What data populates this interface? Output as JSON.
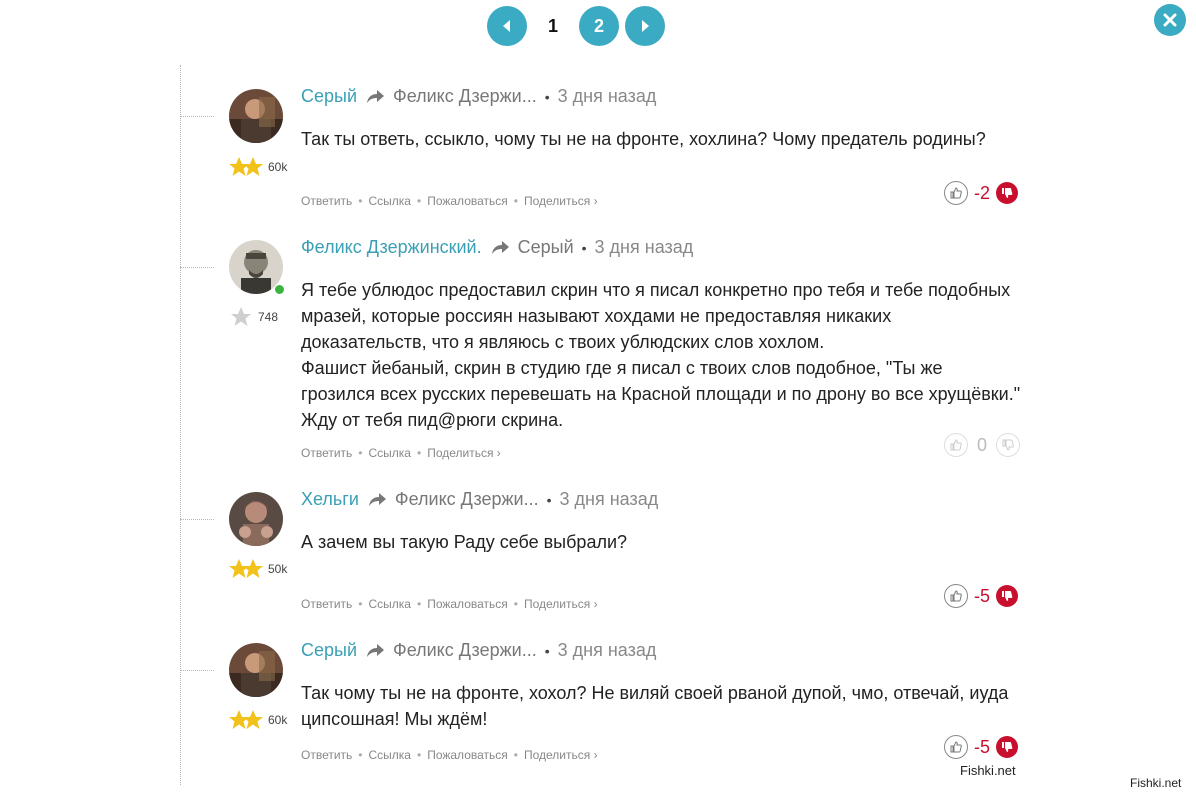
{
  "pagination": {
    "pages": [
      "1",
      "2"
    ],
    "current": "1",
    "accent": "#3aabc3"
  },
  "close_icon": "close-icon",
  "comments": [
    {
      "author": "Серый",
      "reply_to": "Феликс Дзержи...",
      "time": "3 дня назад",
      "rating": "60k",
      "stars": "gold-double",
      "text": [
        "Так ты ответь, ссыкло, чому ты не на фронте, хохлина? Чому предатель родины?"
      ],
      "actions": [
        "Ответить",
        "Ссылка",
        "Пожаловаться",
        "Поделиться ›"
      ],
      "votes": "-2"
    },
    {
      "author": "Феликс Дзержинский.",
      "reply_to": "Серый",
      "time": "3 дня назад",
      "rating": "748",
      "stars": "grey-single",
      "online": true,
      "text": [
        "Я тебе ублюдос предоставил скрин что я писал конкретно про тебя и тебе подобных мразей, которые россиян называют хохдами не предоставляя никаких доказательств, что я являюсь с твоих ублюдских слов хохлом.",
        "Фашист йебаный, скрин в студию где я писал с твоих слов подобное, \"Ты же грозился всех русских перевешать на Красной площади и по дрону во все хрущёвки.\"",
        "Жду от тебя пид@рюги скрина."
      ],
      "actions": [
        "Ответить",
        "Ссылка",
        "Поделиться ›"
      ],
      "votes": "0"
    },
    {
      "author": "Хельги",
      "reply_to": "Феликс Дзержи...",
      "time": "3 дня назад",
      "rating": "50k",
      "stars": "gold-double",
      "text": [
        "А зачем вы такую Раду себе выбрали?"
      ],
      "actions": [
        "Ответить",
        "Ссылка",
        "Пожаловаться",
        "Поделиться ›"
      ],
      "votes": "-5"
    },
    {
      "author": "Серый",
      "reply_to": "Феликс Дзержи...",
      "time": "3 дня назад",
      "rating": "60k",
      "stars": "gold-double",
      "text": [
        "Так чому ты не на фронте, хохол? Не виляй своей рваной дупой, чмо, отвечай, иуда ципсошная! Мы ждём!"
      ],
      "actions": [
        "Ответить",
        "Ссылка",
        "Пожаловаться",
        "Поделиться ›"
      ],
      "votes": "-5"
    }
  ],
  "watermark": "Fishki.net",
  "watermark2": "Fishki.net"
}
